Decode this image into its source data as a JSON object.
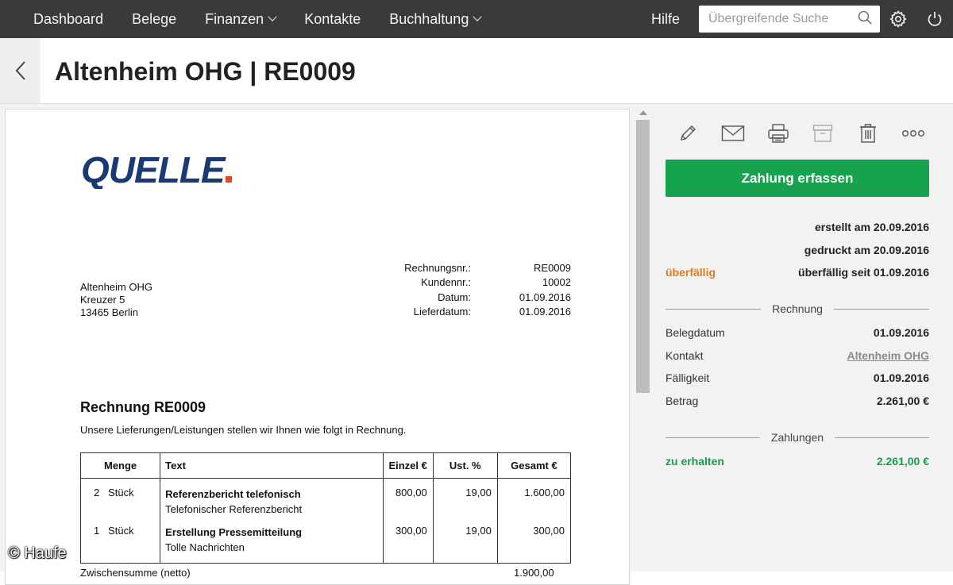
{
  "nav": {
    "items": [
      {
        "label": "Dashboard",
        "dropdown": false
      },
      {
        "label": "Belege",
        "dropdown": false
      },
      {
        "label": "Finanzen",
        "dropdown": true
      },
      {
        "label": "Kontakte",
        "dropdown": false
      },
      {
        "label": "Buchhaltung",
        "dropdown": true
      }
    ],
    "help": "Hilfe",
    "search_placeholder": "Übergreifende Suche"
  },
  "header": {
    "title": "Altenheim OHG | RE0009"
  },
  "document": {
    "logo_text": "QUELLE",
    "recipient": {
      "name": "Altenheim OHG",
      "street": "Kreuzer 5",
      "city": "13465 Berlin"
    },
    "meta": [
      {
        "label": "Rechnungsnr.:",
        "value": "RE0009"
      },
      {
        "label": "Kundennr.:",
        "value": "10002"
      },
      {
        "label": "Datum:",
        "value": "01.09.2016"
      },
      {
        "label": "Lieferdatum:",
        "value": "01.09.2016"
      }
    ],
    "title": "Rechnung RE0009",
    "intro": "Unsere Lieferungen/Leistungen stellen wir Ihnen wie folgt in Rechnung.",
    "columns": [
      "Menge",
      "Text",
      "Einzel €",
      "Ust. %",
      "Gesamt €"
    ],
    "items": [
      {
        "qty": "2",
        "unit": "Stück",
        "title": "Referenzbericht telefonisch",
        "desc": "Telefonischer Referenzbericht",
        "price": "800,00",
        "vat": "19,00",
        "total": "1.600,00"
      },
      {
        "qty": "1",
        "unit": "Stück",
        "title": "Erstellung Pressemitteilung",
        "desc": "Tolle Nachrichten",
        "price": "300,00",
        "vat": "19,00",
        "total": "300,00"
      }
    ],
    "subtotal_label": "Zwischensumme (netto)",
    "subtotal_value": "1.900,00"
  },
  "watermark": "© Haufe",
  "side": {
    "tools": [
      "pencil-icon",
      "mail-icon",
      "printer-icon",
      "archive-icon",
      "trash-icon",
      "more-icon"
    ],
    "pay_button": "Zahlung erfassen",
    "created": "erstellt am 20.09.2016",
    "printed": "gedruckt am 20.09.2016",
    "status_label": "überfällig",
    "status_detail": "überfällig seit 01.09.2016",
    "invoice_section": "Rechnung",
    "fields": [
      {
        "label": "Belegdatum",
        "value": "01.09.2016"
      },
      {
        "label": "Kontakt",
        "value": "Altenheim OHG"
      },
      {
        "label": "Fälligkeit",
        "value": "01.09.2016"
      },
      {
        "label": "Betrag",
        "value": "2.261,00 €"
      }
    ],
    "payments_section": "Zahlungen",
    "receivable_label": "zu erhalten",
    "receivable_value": "2.261,00 €"
  },
  "colors": {
    "nav_bg": "#3a3a3a",
    "primary_green": "#17a24e",
    "overdue_orange": "#e07b1f",
    "logo_blue": "#1b3a73",
    "logo_accent": "#e8452c"
  }
}
